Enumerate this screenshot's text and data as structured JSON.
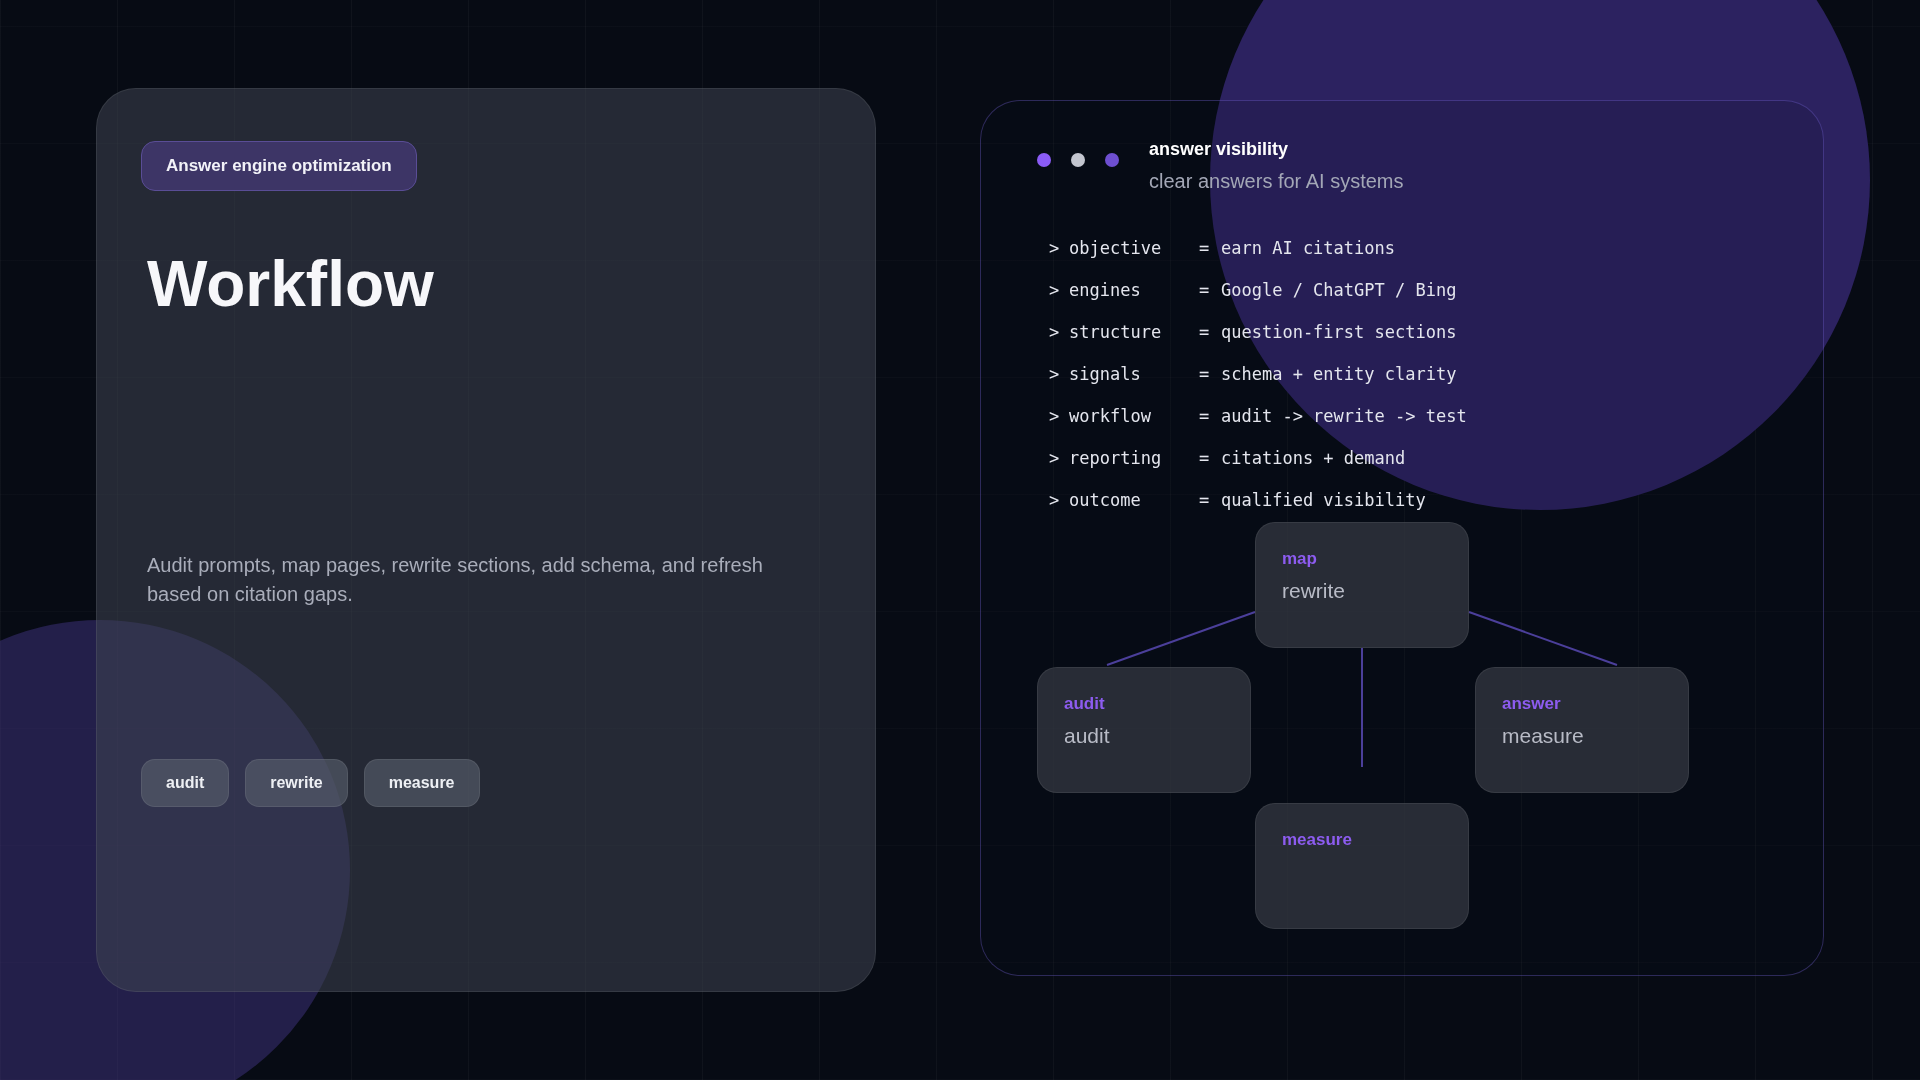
{
  "hero": {
    "badge": "Answer engine optimization",
    "title": "Workflow",
    "description": "Audit prompts, map pages, rewrite sections, add schema, and refresh based on citation gaps.",
    "chips": [
      "audit",
      "rewrite",
      "measure"
    ]
  },
  "card": {
    "dots": [
      {
        "color": "#8b5cf6"
      },
      {
        "color": "#c3c6cf"
      },
      {
        "color": "#6e4fd0"
      }
    ],
    "title": "answer visibility",
    "subtitle": "clear answers for AI systems",
    "lines": [
      {
        "prompt": ">",
        "key": "objective",
        "op": "=",
        "value": "earn AI citations"
      },
      {
        "prompt": ">",
        "key": "engines",
        "op": "=",
        "value": "Google / ChatGPT / Bing"
      },
      {
        "prompt": ">",
        "key": "structure",
        "op": "=",
        "value": "question-first sections"
      },
      {
        "prompt": ">",
        "key": "signals",
        "op": "=",
        "value": "schema + entity clarity"
      },
      {
        "prompt": ">",
        "key": "workflow",
        "op": "=",
        "value": "audit -> rewrite -> test"
      },
      {
        "prompt": ">",
        "key": "reporting",
        "op": "=",
        "value": "citations + demand"
      },
      {
        "prompt": ">",
        "key": "outcome",
        "op": "=",
        "value": "qualified visibility"
      }
    ],
    "diagram": [
      {
        "label": "map",
        "text": "rewrite"
      },
      {
        "label": "audit",
        "text": "audit"
      },
      {
        "label": "answer",
        "text": "measure"
      },
      {
        "label": "measure"
      }
    ]
  }
}
